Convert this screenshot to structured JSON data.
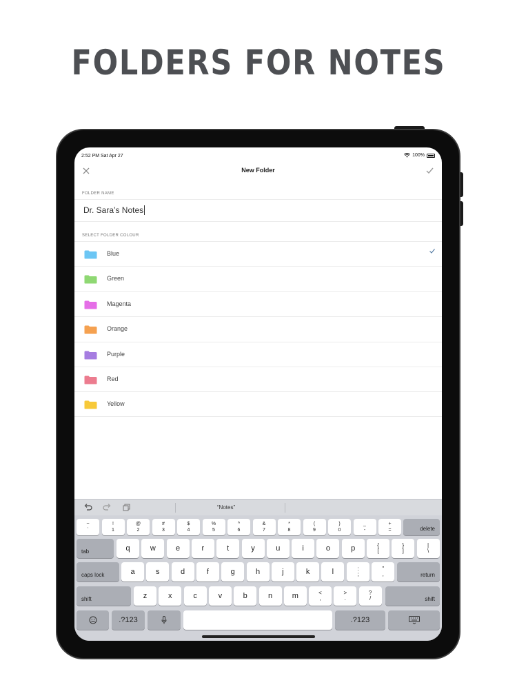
{
  "headline": "FOLDERS FOR NOTES",
  "status": {
    "time": "2:52 PM",
    "date": "Sat Apr 27",
    "battery": "100%"
  },
  "nav": {
    "title": "New Folder"
  },
  "form": {
    "name_label": "FOLDER NAME",
    "name_value": "Dr. Sara’s Notes",
    "colour_label": "SELECT FOLDER COLOUR"
  },
  "colours": [
    {
      "label": "Blue",
      "color": "#6cc5f3",
      "selected": true
    },
    {
      "label": "Green",
      "color": "#8fd873",
      "selected": false
    },
    {
      "label": "Magenta",
      "color": "#e56fe6",
      "selected": false
    },
    {
      "label": "Orange",
      "color": "#f5a150",
      "selected": false
    },
    {
      "label": "Purple",
      "color": "#a67de0",
      "selected": false
    },
    {
      "label": "Red",
      "color": "#ec7c8f",
      "selected": false
    },
    {
      "label": "Yellow",
      "color": "#f7c93a",
      "selected": false
    }
  ],
  "keyboard": {
    "suggestion": "“Notes”",
    "row1": [
      {
        "top": "~",
        "bottom": "`"
      },
      {
        "top": "!",
        "bottom": "1"
      },
      {
        "top": "@",
        "bottom": "2"
      },
      {
        "top": "#",
        "bottom": "3"
      },
      {
        "top": "$",
        "bottom": "4"
      },
      {
        "top": "%",
        "bottom": "5"
      },
      {
        "top": "^",
        "bottom": "6"
      },
      {
        "top": "&",
        "bottom": "7"
      },
      {
        "top": "*",
        "bottom": "8"
      },
      {
        "top": "(",
        "bottom": "9"
      },
      {
        "top": ")",
        "bottom": "0"
      },
      {
        "top": "_",
        "bottom": "-"
      },
      {
        "top": "+",
        "bottom": "="
      }
    ],
    "delete": "delete",
    "tab": "tab",
    "row2": [
      "q",
      "w",
      "e",
      "r",
      "t",
      "y",
      "u",
      "i",
      "o",
      "p"
    ],
    "row2_sym": [
      {
        "top": "{",
        "bottom": "["
      },
      {
        "top": "}",
        "bottom": "]"
      },
      {
        "top": "|",
        "bottom": "\\"
      }
    ],
    "caps": "caps lock",
    "row3": [
      "a",
      "s",
      "d",
      "f",
      "g",
      "h",
      "j",
      "k",
      "l"
    ],
    "row3_sym": [
      {
        "top": ":",
        "bottom": ";"
      },
      {
        "top": "\"",
        "bottom": ","
      }
    ],
    "return": "return",
    "shift": "shift",
    "row4": [
      "z",
      "x",
      "c",
      "v",
      "b",
      "n",
      "m"
    ],
    "row4_sym": [
      {
        "top": "<",
        "bottom": ","
      },
      {
        "top": ">",
        "bottom": "."
      },
      {
        "top": "?",
        "bottom": "/"
      }
    ],
    "num_left": ".?123",
    "num_right": ".?123"
  }
}
